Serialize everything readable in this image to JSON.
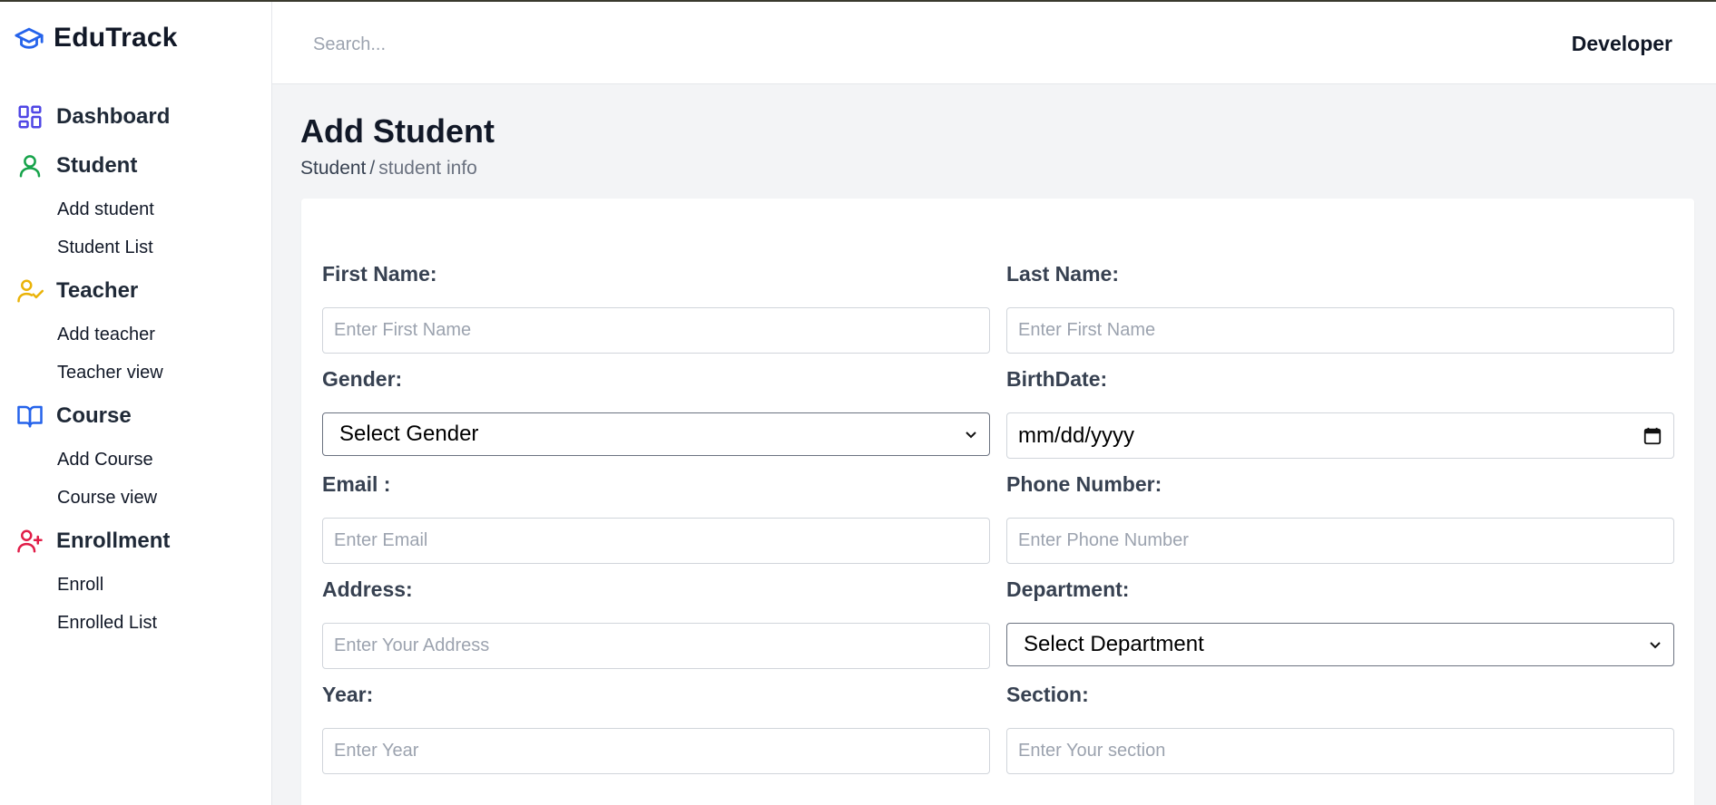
{
  "app": {
    "name": "EduTrack"
  },
  "header": {
    "search_placeholder": "Search...",
    "user_label": "Developer"
  },
  "sidebar": {
    "groups": [
      {
        "label": "Dashboard",
        "icon": "dashboard-grid-icon",
        "color": "#4f46e5",
        "items": []
      },
      {
        "label": "Student",
        "icon": "user-icon",
        "color": "#16a34a",
        "items": [
          "Add student",
          "Student List"
        ]
      },
      {
        "label": "Teacher",
        "icon": "user-check-icon",
        "color": "#eab308",
        "items": [
          "Add teacher",
          "Teacher view"
        ]
      },
      {
        "label": "Course",
        "icon": "book-open-icon",
        "color": "#2563eb",
        "items": [
          "Add Course",
          "Course view"
        ]
      },
      {
        "label": "Enrollment",
        "icon": "user-plus-icon",
        "color": "#e11d48",
        "items": [
          "Enroll",
          "Enrolled List"
        ]
      }
    ]
  },
  "page": {
    "title": "Add Student",
    "breadcrumb": {
      "parent": "Student",
      "separator": "/",
      "current": "student info"
    }
  },
  "form": {
    "first_name": {
      "label": "First Name:",
      "placeholder": "Enter First Name"
    },
    "last_name": {
      "label": "Last Name:",
      "placeholder": "Enter First Name"
    },
    "gender": {
      "label": "Gender:",
      "selected": "Select Gender"
    },
    "birthdate": {
      "label": "BirthDate:",
      "value": "mm/dd/yyyy"
    },
    "email": {
      "label": "Email :",
      "placeholder": "Enter Email"
    },
    "phone": {
      "label": "Phone Number:",
      "placeholder": "Enter Phone Number"
    },
    "address": {
      "label": "Address:",
      "placeholder": "Enter Your Address"
    },
    "department": {
      "label": "Department:",
      "selected": "Select Department"
    },
    "year": {
      "label": "Year:",
      "placeholder": "Enter Year"
    },
    "section": {
      "label": "Section:",
      "placeholder": "Enter Your section"
    }
  },
  "colors": {
    "brand": "#2563eb",
    "page_bg": "#f3f4f6"
  }
}
